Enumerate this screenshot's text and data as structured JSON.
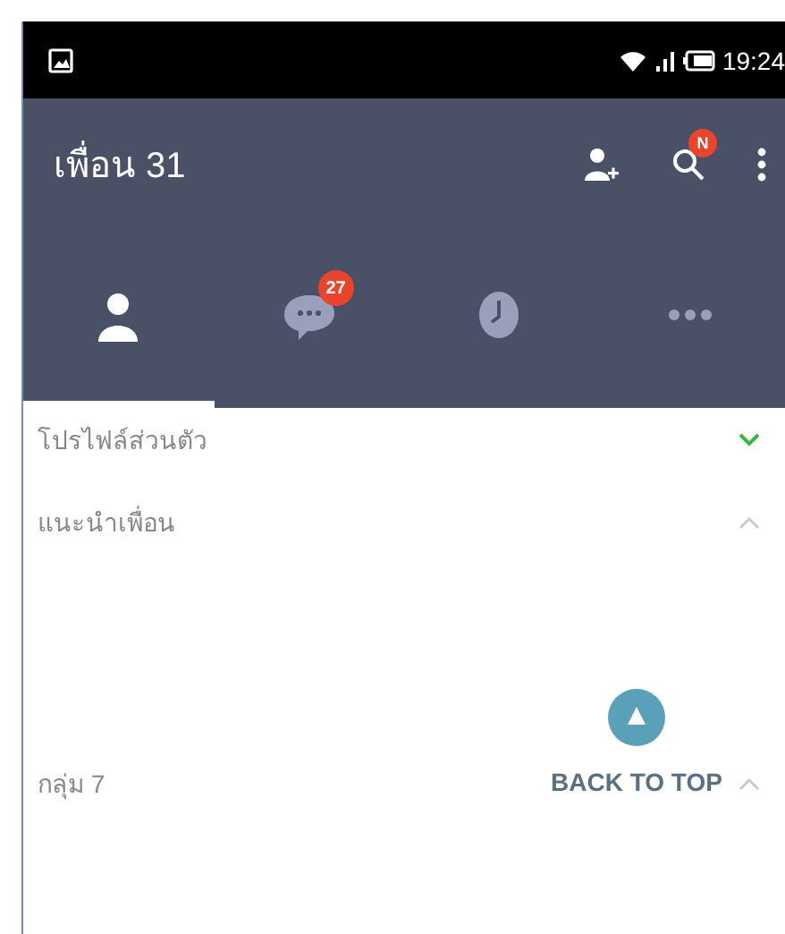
{
  "status_bar": {
    "time": "19:24"
  },
  "app_bar": {
    "title": "เพื่อน 31",
    "search_badge": "N"
  },
  "tabs": [
    {
      "kind": "person",
      "selected": true
    },
    {
      "kind": "chat",
      "selected": false,
      "badge": "27"
    },
    {
      "kind": "clock",
      "selected": false
    },
    {
      "kind": "more",
      "selected": false
    }
  ],
  "sections": [
    {
      "label": "โปรไฟล์ส่วนตัว",
      "expanded": false
    },
    {
      "label": "แนะนำเพื่อน",
      "expanded": true
    },
    {
      "label": "กลุ่ม 7",
      "expanded": true
    }
  ],
  "back_to_top": {
    "label": "BACK TO TOP"
  }
}
